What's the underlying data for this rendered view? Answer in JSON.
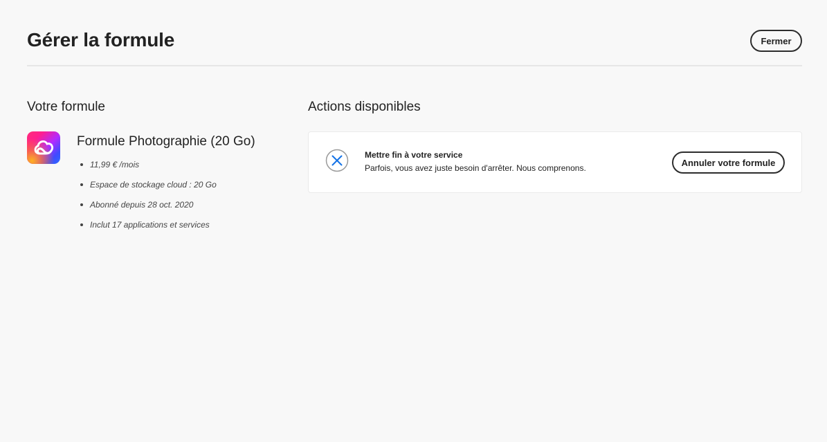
{
  "header": {
    "title": "Gérer la formule",
    "close_label": "Fermer"
  },
  "plan": {
    "section_title": "Votre formule",
    "icon": "creative-cloud-icon",
    "name": "Formule Photographie (20 Go)",
    "details": [
      "11,99 € /mois",
      "Espace de stockage cloud : 20 Go",
      "Abonné depuis 28 oct. 2020",
      "Inclut 17 applications et services"
    ]
  },
  "actions": {
    "section_title": "Actions disponibles",
    "cancel": {
      "icon": "close-circle-icon",
      "title": "Mettre fin à votre service",
      "description": "Parfois, vous avez juste besoin d'arrêter. Nous comprenons.",
      "button_label": "Annuler votre formule",
      "icon_color": "#1473e6"
    }
  }
}
